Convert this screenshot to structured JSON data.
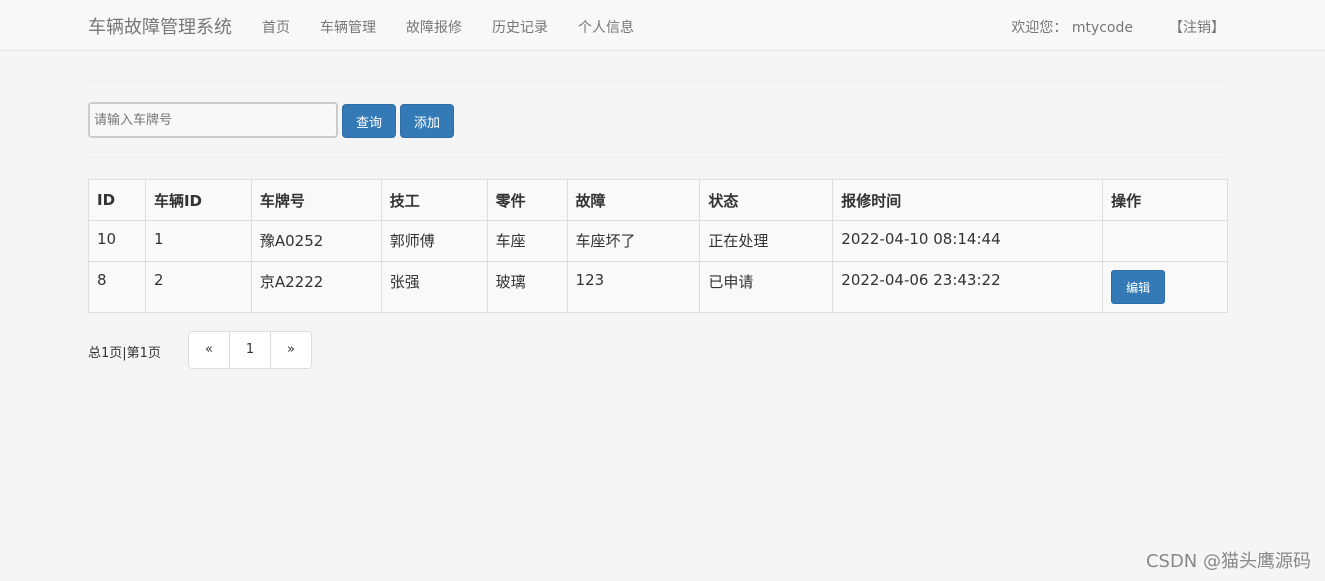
{
  "navbar": {
    "brand": "车辆故障管理系统",
    "links": [
      "首页",
      "车辆管理",
      "故障报修",
      "历史记录",
      "个人信息"
    ],
    "welcome": "欢迎您： mtycode",
    "logout": "【注销】"
  },
  "search": {
    "placeholder": "请输入车牌号",
    "value": "",
    "query_label": "查询",
    "add_label": "添加"
  },
  "table": {
    "headers": [
      "ID",
      "车辆ID",
      "车牌号",
      "技工",
      "零件",
      "故障",
      "状态",
      "报修时间",
      "操作"
    ],
    "rows": [
      {
        "id": "10",
        "vehicle_id": "1",
        "plate": "豫A0252",
        "technician": "郭师傅",
        "part": "车座",
        "fault": "车座坏了",
        "status": "正在处理",
        "time": "2022-04-10 08:14:44",
        "action": ""
      },
      {
        "id": "8",
        "vehicle_id": "2",
        "plate": "京A2222",
        "technician": "张强",
        "part": "玻璃",
        "fault": "123",
        "status": "已申请",
        "time": "2022-04-06 23:43:22",
        "action": "编辑"
      }
    ]
  },
  "pagination": {
    "info": "总1页|第1页",
    "prev": "«",
    "current": "1",
    "next": "»"
  },
  "watermark": "CSDN @猫头鹰源码"
}
